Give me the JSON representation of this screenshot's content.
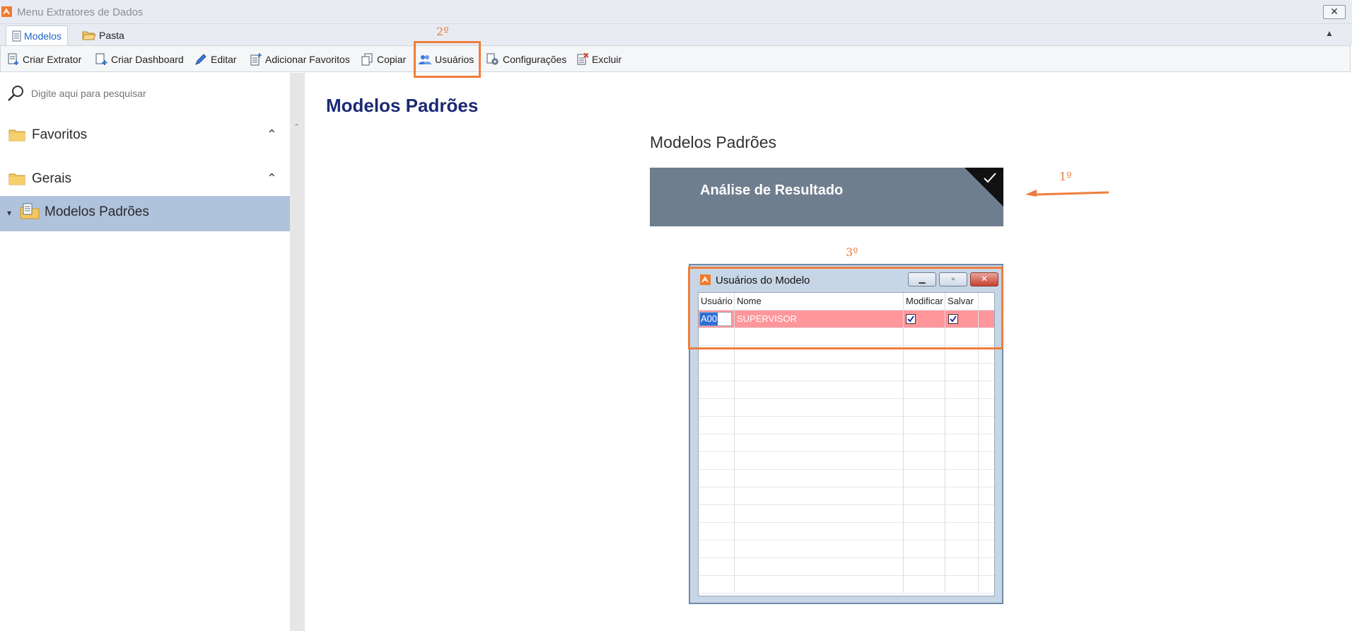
{
  "window": {
    "title": "Menu Extratores de Dados",
    "close_glyph": "✕"
  },
  "tabs": [
    {
      "label": "Modelos",
      "icon": "document-icon",
      "active": true
    },
    {
      "label": "Pasta",
      "icon": "folder-open-icon",
      "active": false
    }
  ],
  "toolbar": {
    "buttons": [
      {
        "label": "Criar Extrator",
        "icon": "new-document-icon"
      },
      {
        "label": "Criar Dashboard",
        "icon": "new-dashboard-icon"
      },
      {
        "label": "Editar",
        "icon": "pencil-icon"
      },
      {
        "label": "Adicionar Favoritos",
        "icon": "add-favorite-icon"
      },
      {
        "label": "Copiar",
        "icon": "copy-icon"
      },
      {
        "label": "Usuários",
        "icon": "users-icon"
      },
      {
        "label": "Configurações",
        "icon": "settings-icon"
      },
      {
        "label": "Excluir",
        "icon": "delete-icon"
      }
    ]
  },
  "sidebar": {
    "search_placeholder": "Digite aqui para pesquisar",
    "groups": [
      {
        "label": "Favoritos",
        "icon": "folder-icon",
        "expanded": true
      },
      {
        "label": "Gerais",
        "icon": "folder-icon",
        "expanded": true
      }
    ],
    "selected_item": {
      "label": "Modelos Padrões",
      "icon": "models-folder-icon"
    }
  },
  "main": {
    "title": "Modelos Padrões",
    "section_title": "Modelos Padrões",
    "card": {
      "name": "Análise de Resultado",
      "checked": true
    }
  },
  "annotations": {
    "first": "1º",
    "second": "2º",
    "third": "3º",
    "color": "#ef7d3c"
  },
  "dialog": {
    "title": "Usuários do Modelo",
    "columns": [
      "Usuário",
      "Nome",
      "Modificar",
      "Salvar"
    ],
    "rows": [
      {
        "usuario": "A00",
        "nome": "SUPERVISOR",
        "modificar": true,
        "salvar": true,
        "selected": true
      }
    ],
    "empty_rows": 15
  },
  "colors": {
    "accent_blue": "#1e63c4",
    "title_navy": "#1b2a74",
    "card_gray": "#6f7e8f",
    "selected_row": "#ff969b",
    "sidebar_selected": "#b0c3dc"
  }
}
